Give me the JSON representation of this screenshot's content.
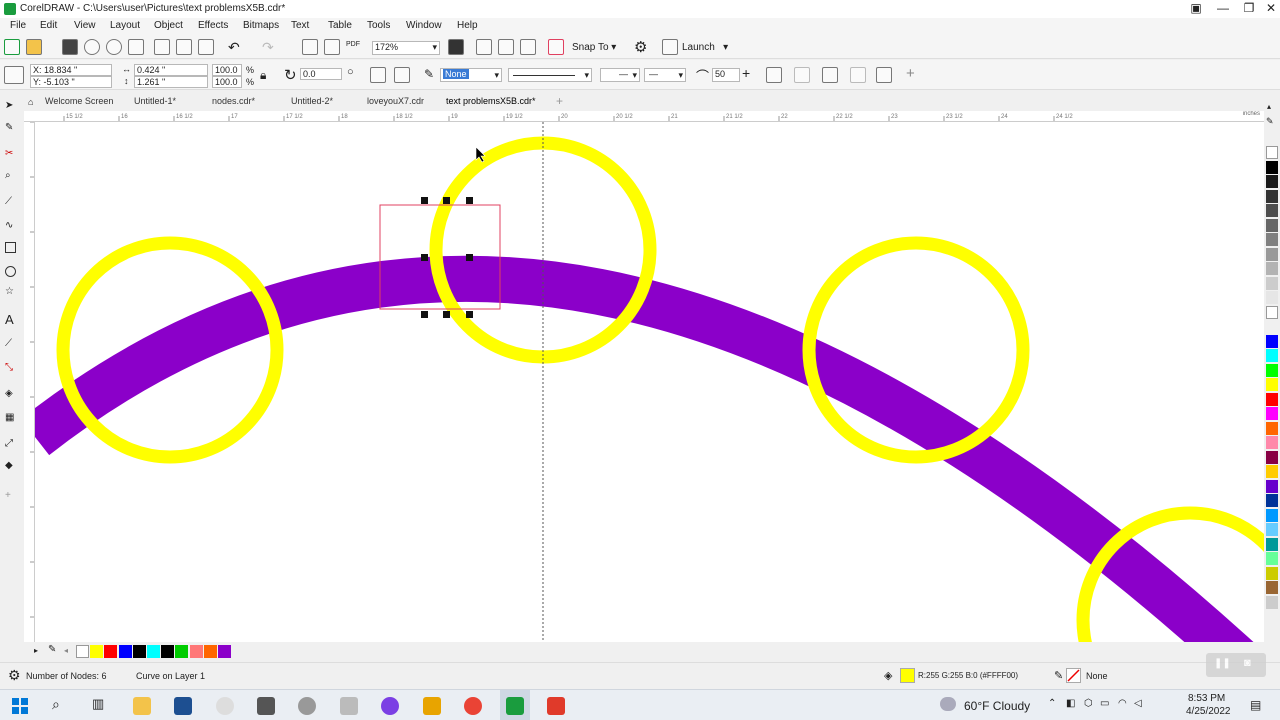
{
  "window": {
    "title": "CorelDRAW - C:\\Users\\user\\Pictures\\text problemsX5B.cdr*"
  },
  "menu": [
    "File",
    "Edit",
    "View",
    "Layout",
    "Object",
    "Effects",
    "Bitmaps",
    "Text",
    "Table",
    "Tools",
    "Window",
    "Help"
  ],
  "standard_toolbar": {
    "zoom": "172%",
    "snap_to": "Snap To",
    "launch": "Launch",
    "pdf_label": "PDF"
  },
  "property_bar": {
    "x": "X: 18.834 \"",
    "y": "Y: -5.103 \"",
    "width": "0.424 \"",
    "height": "1.261 \"",
    "scale_w": "100.0",
    "scale_h": "100.0",
    "percent": "%",
    "rotation": "0.0",
    "outline_width": "None",
    "smoothing": "50"
  },
  "tabs": [
    {
      "label": "Welcome Screen",
      "active": false
    },
    {
      "label": "Untitled-1*",
      "active": false
    },
    {
      "label": "nodes.cdr*",
      "active": false
    },
    {
      "label": "Untitled-2*",
      "active": false
    },
    {
      "label": "loveyouX7.cdr",
      "active": false
    },
    {
      "label": "text problemsX5B.cdr*",
      "active": true
    }
  ],
  "ruler": {
    "h_ticks": [
      "15 1/2",
      "16",
      "16 1/2",
      "17",
      "17 1/2",
      "18",
      "18 1/2",
      "19",
      "19 1/2",
      "20",
      "20 1/2",
      "21",
      "21 1/2",
      "22",
      "22 1/2",
      "23",
      "23 1/2",
      "24",
      "24 1/2"
    ],
    "unit": "inches"
  },
  "status": {
    "nodes": "Number of Nodes: 6",
    "layer": "Curve on Layer 1",
    "fill_info": "R:255 G:255 B:0 (#FFFF00)",
    "outline_info": "None"
  },
  "colors": {
    "arc": "#8b00c9",
    "ring": "#ffff00",
    "selection": "#e04060",
    "accent_green": "#1a9c3e"
  },
  "document_palette": [
    "#ffffff",
    "#ffff00",
    "#ff0000",
    "#0000ff",
    "#000000",
    "#00ffff",
    "#000000",
    "#00cc00",
    "#ff7777",
    "#ff6600",
    "#8b00c9"
  ],
  "color_palette": [
    "#ffffff",
    "#000000",
    "#1a1a1a",
    "#333333",
    "#4d4d4d",
    "#666666",
    "#808080",
    "#999999",
    "#b3b3b3",
    "#cccccc",
    "#e6e6e6",
    "#ffffff",
    "#f0f0f0",
    "#0000ff",
    "#00ffff",
    "#00ff00",
    "#ffff00",
    "#ff0000",
    "#ff00ff",
    "#ff6600",
    "#ff88aa",
    "#880044",
    "#ffcc00",
    "#6600cc",
    "#003399",
    "#0099ff",
    "#66ccff",
    "#009999",
    "#66ff99",
    "#cccc00",
    "#996633",
    "#cccccc"
  ],
  "taskbar": {
    "weather": "60°F  Cloudy",
    "time": "8:53 PM",
    "date": "4/25/2022"
  }
}
